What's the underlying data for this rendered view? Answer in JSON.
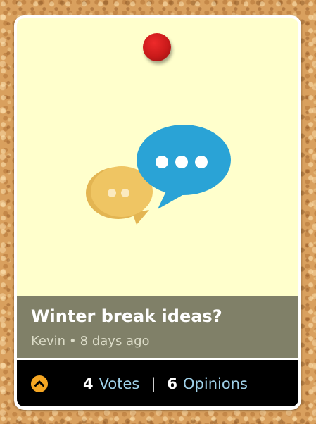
{
  "idea": {
    "title": "Winter break ideas?",
    "author": "Kevin",
    "separator": "•",
    "age": "8 days ago"
  },
  "footer": {
    "votes_count": "4",
    "votes_label": "Votes",
    "divider": "|",
    "opinions_count": "6",
    "opinions_label": "Opinions"
  },
  "icons": {
    "pin": "red-pushpin-icon",
    "illustration": "chat-bubbles-icon",
    "upvote": "chevron-up-circle-icon"
  },
  "colors": {
    "note_background": "#ffffcc",
    "caption_background": "#808068",
    "footer_background": "#000000",
    "accent_orange": "#f5a623",
    "link_blue": "#9fd0e8",
    "bubble_blue": "#2aa3d6",
    "bubble_yellow": "#efc563",
    "pin_red": "#d42020"
  }
}
